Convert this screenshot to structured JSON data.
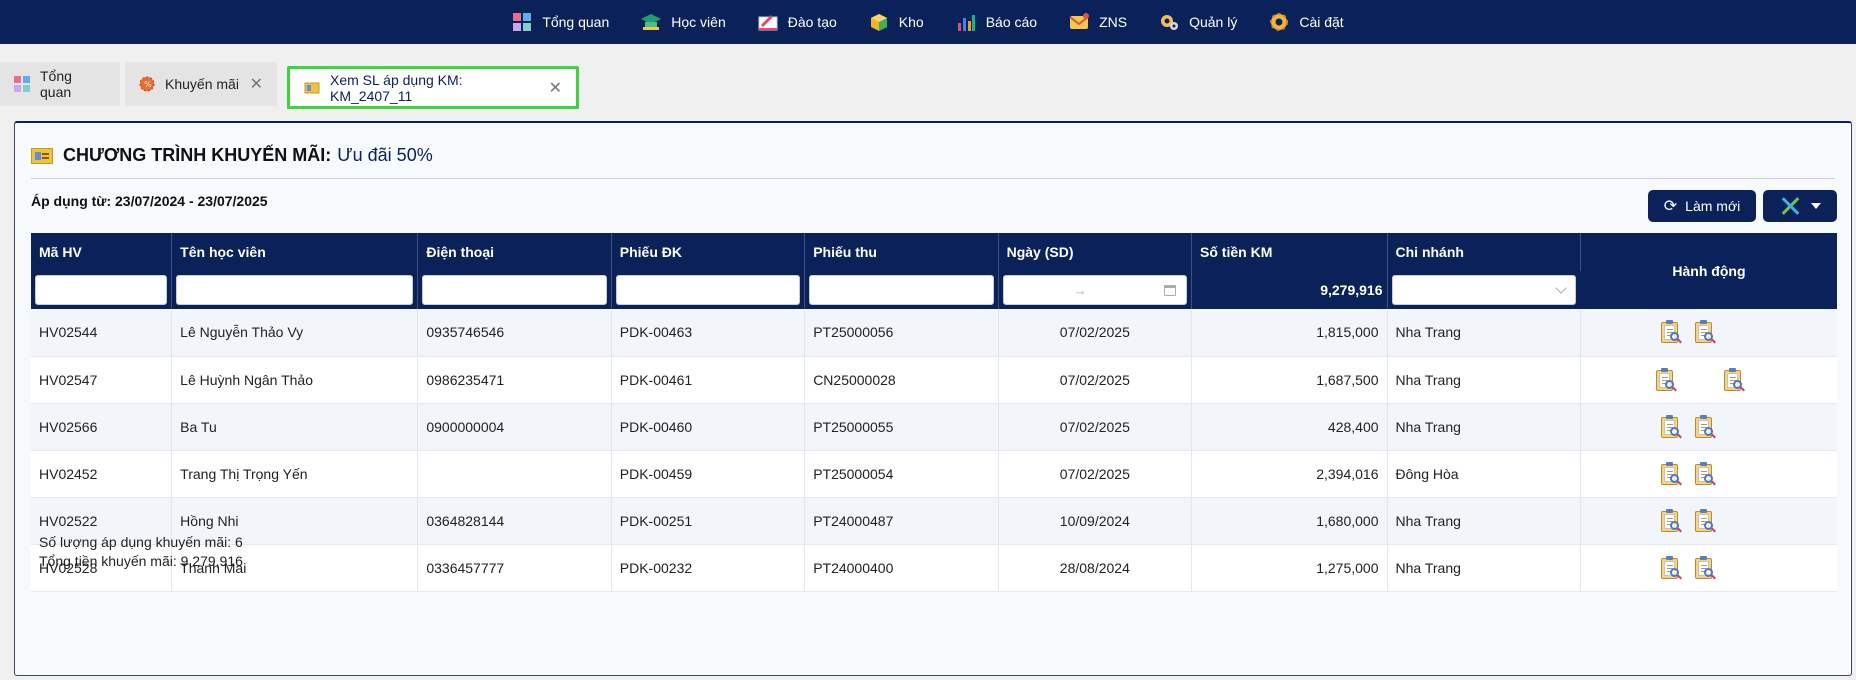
{
  "nav": {
    "items": [
      {
        "label": "Tổng quan",
        "icon": "dashboard-icon"
      },
      {
        "label": "Học viên",
        "icon": "student-icon"
      },
      {
        "label": "Đào tạo",
        "icon": "training-icon"
      },
      {
        "label": "Kho",
        "icon": "warehouse-icon"
      },
      {
        "label": "Báo cáo",
        "icon": "report-icon"
      },
      {
        "label": "ZNS",
        "icon": "zns-icon"
      },
      {
        "label": "Quản lý",
        "icon": "management-icon"
      },
      {
        "label": "Cài đặt",
        "icon": "settings-icon"
      }
    ]
  },
  "tabs": [
    {
      "label": "Tổng quan",
      "closable": false
    },
    {
      "label": "Khuyến mãi",
      "closable": true
    },
    {
      "label": "Xem SL áp dụng KM: KM_2407_11",
      "closable": true,
      "active": true
    }
  ],
  "panel": {
    "title_prefix": "CHƯƠNG TRÌNH KHUYẾN MÃI:",
    "title_name": "Ưu đãi 50%",
    "apply_range": "Áp dụng từ: 23/07/2024 - 23/07/2025",
    "refresh_label": "Làm mới"
  },
  "table": {
    "headers": [
      "Mã HV",
      "Tên học viên",
      "Điện thoại",
      "Phiếu ĐK",
      "Phiếu thu",
      "Ngày (SD)",
      "Số tiền KM",
      "Chi nhánh",
      "Hành động"
    ],
    "date_filter_arrow": "→",
    "sum_total": "9,279,916",
    "rows": [
      {
        "ma_hv": "HV02544",
        "ten": "Lê Nguyễn Thảo Vy",
        "dien_thoai": "0935746546",
        "phieu_dk": "PDK-00463",
        "phieu_thu": "PT25000056",
        "ngay": "07/02/2025",
        "so_tien": "1,815,000",
        "chi_nhanh": "Nha Trang"
      },
      {
        "ma_hv": "HV02547",
        "ten": "Lê Huỳnh Ngân Thảo",
        "dien_thoai": "0986235471",
        "phieu_dk": "PDK-00461",
        "phieu_thu": "CN25000028",
        "ngay": "07/02/2025",
        "so_tien": "1,687,500",
        "chi_nhanh": "Nha Trang"
      },
      {
        "ma_hv": "HV02566",
        "ten": "Ba Tu",
        "dien_thoai": "0900000004",
        "phieu_dk": "PDK-00460",
        "phieu_thu": "PT25000055",
        "ngay": "07/02/2025",
        "so_tien": "428,400",
        "chi_nhanh": "Nha Trang"
      },
      {
        "ma_hv": "HV02452",
        "ten": "Trang Thị Trọng Yến",
        "dien_thoai": "",
        "phieu_dk": "PDK-00459",
        "phieu_thu": "PT25000054",
        "ngay": "07/02/2025",
        "so_tien": "2,394,016",
        "chi_nhanh": "Đông Hòa"
      },
      {
        "ma_hv": "HV02522",
        "ten": "Hồng Nhi",
        "dien_thoai": "0364828144",
        "phieu_dk": "PDK-00251",
        "phieu_thu": "PT24000487",
        "ngay": "10/09/2024",
        "so_tien": "1,680,000",
        "chi_nhanh": "Nha Trang"
      },
      {
        "ma_hv": "HV02528",
        "ten": "Thanh Mai",
        "dien_thoai": "0336457777",
        "phieu_dk": "PDK-00232",
        "phieu_thu": "PT24000400",
        "ngay": "28/08/2024",
        "so_tien": "1,275,000",
        "chi_nhanh": "Nha Trang"
      }
    ]
  },
  "summary": {
    "count_text": "Số lượng áp dụng khuyến mãi: 6",
    "total_text": "Tổng tiền khuyến mãi: 9,279,916"
  },
  "colors": {
    "navy": "#0a2159",
    "active_tab_border": "#3ad63a"
  }
}
